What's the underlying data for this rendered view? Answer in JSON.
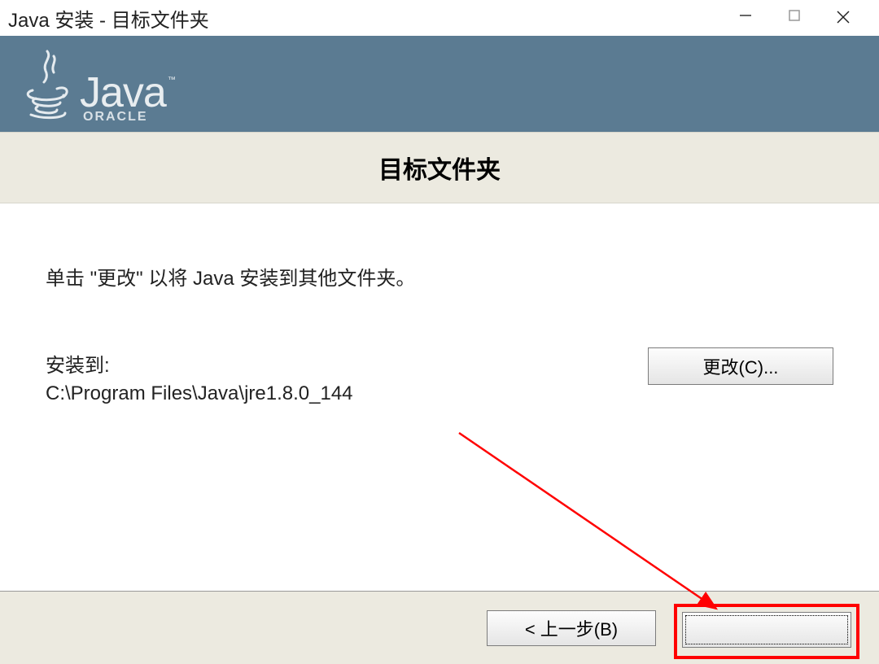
{
  "titlebar": {
    "title": "Java 安装 - 目标文件夹"
  },
  "banner": {
    "brand": "Java",
    "tm": "™",
    "oracle": "ORACLE"
  },
  "subheader": {
    "title": "目标文件夹"
  },
  "main": {
    "instruction": "单击 \"更改\" 以将 Java 安装到其他文件夹。",
    "install_label": "安装到:",
    "install_path": "C:\\Program Files\\Java\\jre1.8.0_144",
    "change_label": "更改(C)..."
  },
  "footer": {
    "back_label": "< 上一步(B)",
    "next_label": ""
  }
}
